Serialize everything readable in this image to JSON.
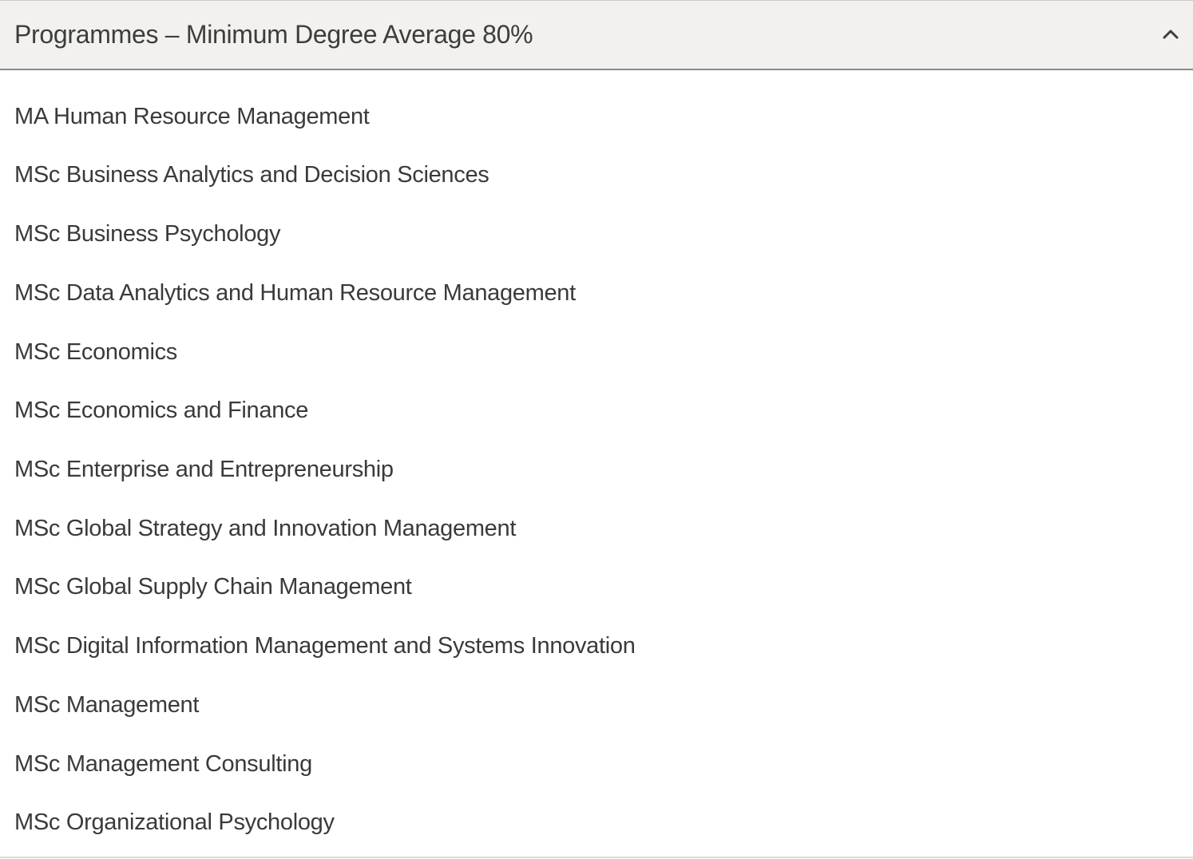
{
  "accordion": {
    "title": "Programmes – Minimum Degree Average 80%",
    "toggle_icon": "chevron-up-icon",
    "expanded": true,
    "colors": {
      "header_background": "#f2f1ef",
      "header_border": "#8e8a82",
      "text": "#3a3a3a",
      "page_background": "#ffffff"
    },
    "programmes": [
      {
        "label": "MA Human Resource Management"
      },
      {
        "label": "MSc Business Analytics and Decision Sciences"
      },
      {
        "label": "MSc Business Psychology"
      },
      {
        "label": "MSc Data Analytics and Human Resource Management"
      },
      {
        "label": "MSc Economics"
      },
      {
        "label": "MSc Economics and Finance"
      },
      {
        "label": "MSc Enterprise and Entrepreneurship"
      },
      {
        "label": "MSc Global Strategy and Innovation Management"
      },
      {
        "label": "MSc Global Supply Chain Management"
      },
      {
        "label": "MSc Digital Information Management and Systems Innovation"
      },
      {
        "label": "MSc Management"
      },
      {
        "label": "MSc Management Consulting"
      },
      {
        "label": "MSc Organizational Psychology"
      }
    ]
  }
}
